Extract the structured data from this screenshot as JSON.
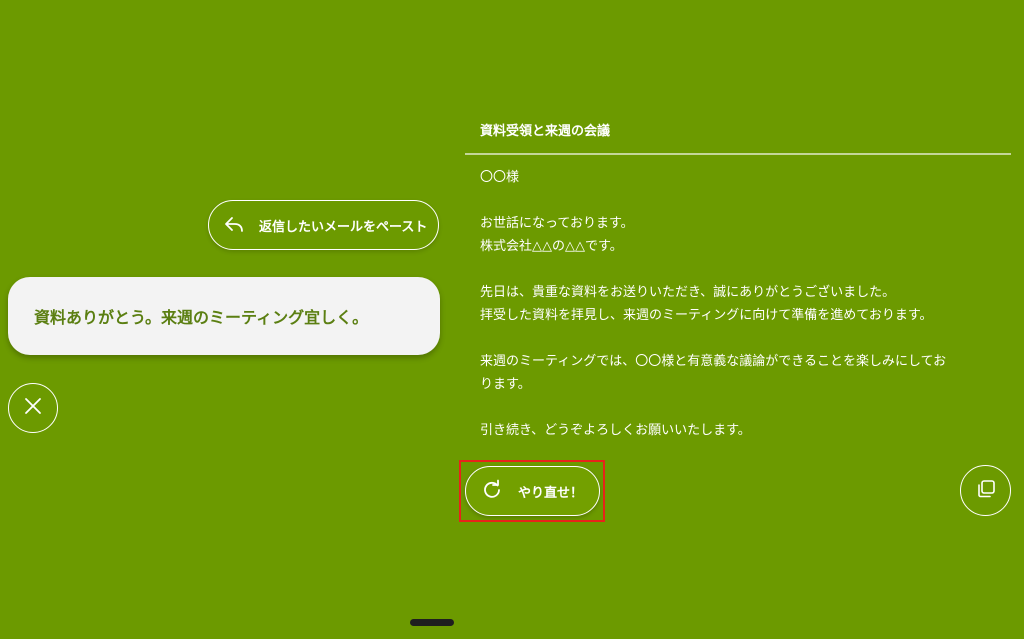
{
  "paste_button": {
    "label": "返信したいメールをペースト",
    "icon": "reply-arrow-icon"
  },
  "input": {
    "text": "資料ありがとう。来週のミーティング宜しく。"
  },
  "close_button": {
    "icon": "close-icon"
  },
  "email": {
    "subject": "資料受領と来週の会議",
    "greeting": "〇〇様",
    "para1": [
      "お世話になっております。",
      "株式会社△△の△△です。"
    ],
    "para2": [
      "先日は、貴重な資料をお送りいただき、誠にありがとうございました。",
      "拝受した資料を拝見し、来週のミーティングに向けて準備を進めております。"
    ],
    "para3": [
      "来週のミーティングでは、〇〇様と有意義な議論ができることを楽しみにしてお",
      "ります。"
    ],
    "closing": "引き続き、どうぞよろしくお願いいたします。"
  },
  "redo_button": {
    "label": "やり直せ！",
    "icon": "refresh-icon"
  },
  "copy_button": {
    "icon": "copy-icon"
  },
  "colors": {
    "background": "#6c9a00",
    "input_text": "#5b7f12",
    "highlight": "#e8231a"
  }
}
